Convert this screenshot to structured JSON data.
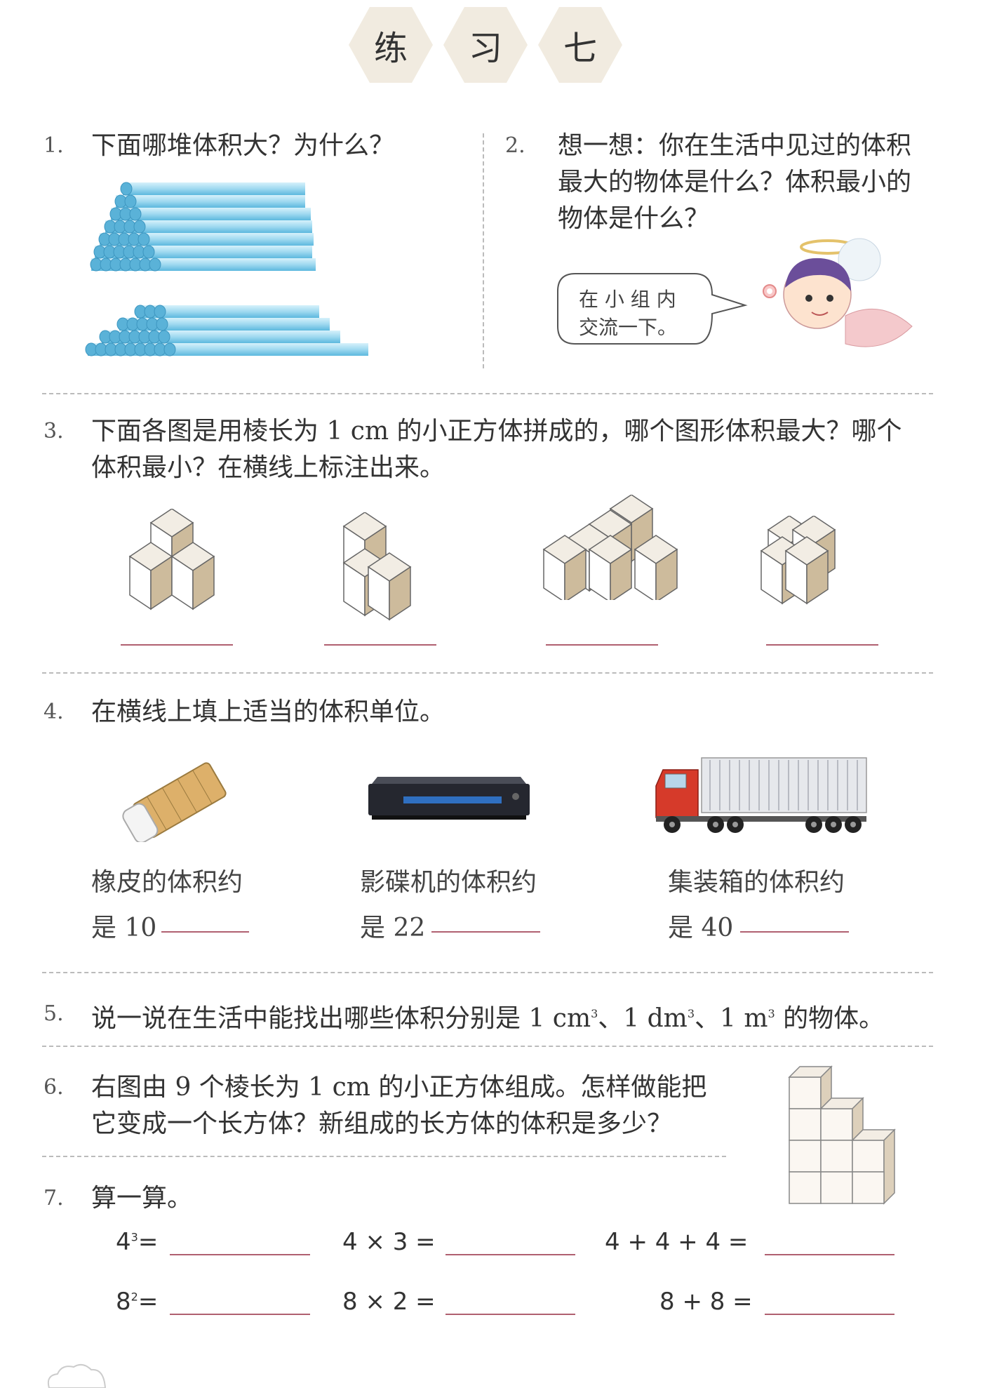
{
  "title": [
    "练",
    "习",
    "七"
  ],
  "q1": {
    "num": "1.",
    "text": "下面哪堆体积大？为什么？"
  },
  "q2": {
    "num": "2.",
    "lines": [
      "想一想：你在生活中见过的体积",
      "最大的物体是什么？体积最小的",
      "物体是什么？"
    ],
    "bubble": [
      "在 小 组 内",
      "交流一下。"
    ]
  },
  "q3": {
    "num": "3.",
    "lines": [
      "下面各图是用棱长为 1 cm 的小正方体拼成的，哪个图形体积最大？哪个",
      "体积最小？在横线上标注出来。"
    ]
  },
  "q4": {
    "num": "4.",
    "text": "在横线上填上适当的体积单位。",
    "items": [
      {
        "label": "橡皮的体积约",
        "value": "是 10"
      },
      {
        "label": "影碟机的体积约",
        "value": "是 22"
      },
      {
        "label": "集装箱的体积约",
        "value": "是 40"
      }
    ]
  },
  "q5": {
    "num": "5.",
    "text_a": "说一说在生活中能找出哪些体积分别是 1 cm",
    "sup1": "3",
    "text_b": "、1 dm",
    "sup2": "3",
    "text_c": "、1 m",
    "sup3": "3",
    "text_d": " 的物体。"
  },
  "q6": {
    "num": "6.",
    "lines": [
      "右图由 9 个棱长为 1 cm 的小正方体组成。怎样做能把",
      "它变成一个长方体？新组成的长方体的体积是多少？"
    ]
  },
  "q7": {
    "num": "7.",
    "text": "算一算。",
    "row1": {
      "a_base": "4",
      "a_sup": "3",
      "a_eq": "=",
      "b": "4 × 3 =",
      "c": "4 + 4 + 4 ="
    },
    "row2": {
      "a_base": "8",
      "a_sup": "2",
      "a_eq": "=",
      "b": "8 × 2 =",
      "c": "8 + 8 ="
    }
  }
}
